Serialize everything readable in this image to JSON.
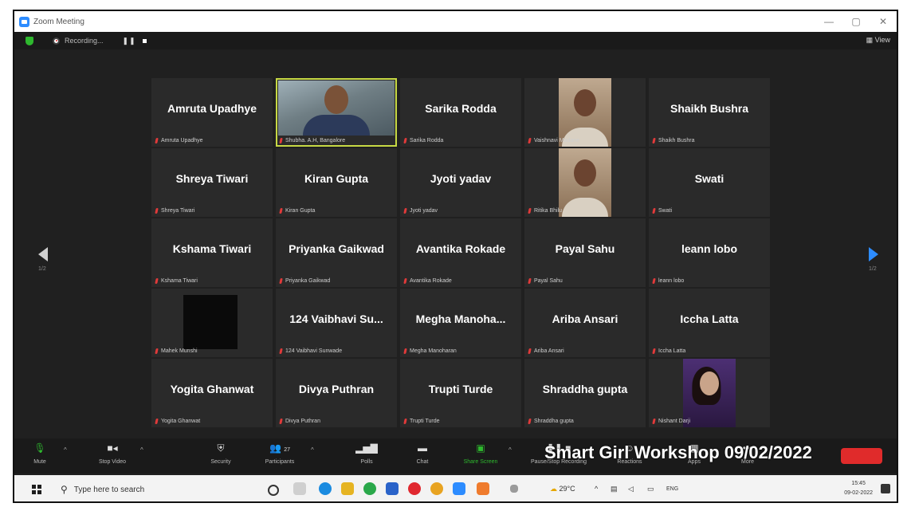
{
  "window": {
    "title": "Zoom Meeting",
    "view_label": "View",
    "minimize": "—",
    "restore": "▢",
    "close": "✕"
  },
  "topbar": {
    "recording_label": "Recording...",
    "pause_label": "❚❚"
  },
  "participants": [
    {
      "name": "Amruta Upadhye",
      "footer": "Amruta Upadhye"
    },
    {
      "name": "",
      "footer": "Shubha. A.H, Bangalore",
      "video": "main"
    },
    {
      "name": "Sarika Rodda",
      "footer": "Sarika Rodda"
    },
    {
      "name": "",
      "footer": "Vaishnavi Madane",
      "video": "face"
    },
    {
      "name": "Shaikh Bushra",
      "footer": "Shaikh Bushra"
    },
    {
      "name": "Shreya Tiwari",
      "footer": "Shreya Tiwari"
    },
    {
      "name": "Kiran Gupta",
      "footer": "Kiran Gupta"
    },
    {
      "name": "Jyoti yadav",
      "footer": "Jyoti yadav"
    },
    {
      "name": "",
      "footer": "Ritika Bhilu",
      "video": "face"
    },
    {
      "name": "Swati",
      "footer": "Swati"
    },
    {
      "name": "Kshama Tiwari",
      "footer": "Kshama Tiwari"
    },
    {
      "name": "Priyanka Gaikwad",
      "footer": "Priyanka Gaikwad"
    },
    {
      "name": "Avantika Rokade",
      "footer": "Avantika Rokade"
    },
    {
      "name": "Payal Sahu",
      "footer": "Payal Sahu"
    },
    {
      "name": "leann lobo",
      "footer": "leann lobo"
    },
    {
      "name": "",
      "footer": "Mahek Munshi",
      "video": "black"
    },
    {
      "name": "124 Vaibhavi Su...",
      "footer": "124 Vaibhavi Sunwade"
    },
    {
      "name": "Megha Manoha...",
      "footer": "Megha Manoharan"
    },
    {
      "name": "Ariba Ansari",
      "footer": "Ariba Ansari"
    },
    {
      "name": "Iccha Latta",
      "footer": "Iccha Latta"
    },
    {
      "name": "Yogita Ghanwat",
      "footer": "Yogita Ghanwat"
    },
    {
      "name": "Divya Puthran",
      "footer": "Divya Puthran"
    },
    {
      "name": "Trupti Turde",
      "footer": "Trupti Turde"
    },
    {
      "name": "Shraddha gupta",
      "footer": "Shraddha gupta"
    },
    {
      "name": "",
      "footer": "Nishant Darji",
      "video": "girl"
    }
  ],
  "pager": {
    "left": "1/2",
    "right": "1/2"
  },
  "toolbar": {
    "mute": "Mute",
    "stop_video": "Stop Video",
    "security": "Security",
    "participants": "Participants",
    "participants_count": "27",
    "polls": "Polls",
    "chat": "Chat",
    "share_screen": "Share Screen",
    "pause_recording": "Pause/Stop Recording",
    "reactions": "Reactions",
    "apps": "Apps",
    "more": "More"
  },
  "overlay_text": "Smart Girl Workshop 09/02/2022",
  "taskbar": {
    "search_placeholder": "Type here to search",
    "weather": "29°C",
    "language": "ENG",
    "time": "15:45",
    "date": "09-02-2022"
  },
  "colors": {
    "accent": "#2d8cff",
    "active_speaker": "#c7d944",
    "share_green": "#2eb82e",
    "end_red": "#e02b2b"
  }
}
